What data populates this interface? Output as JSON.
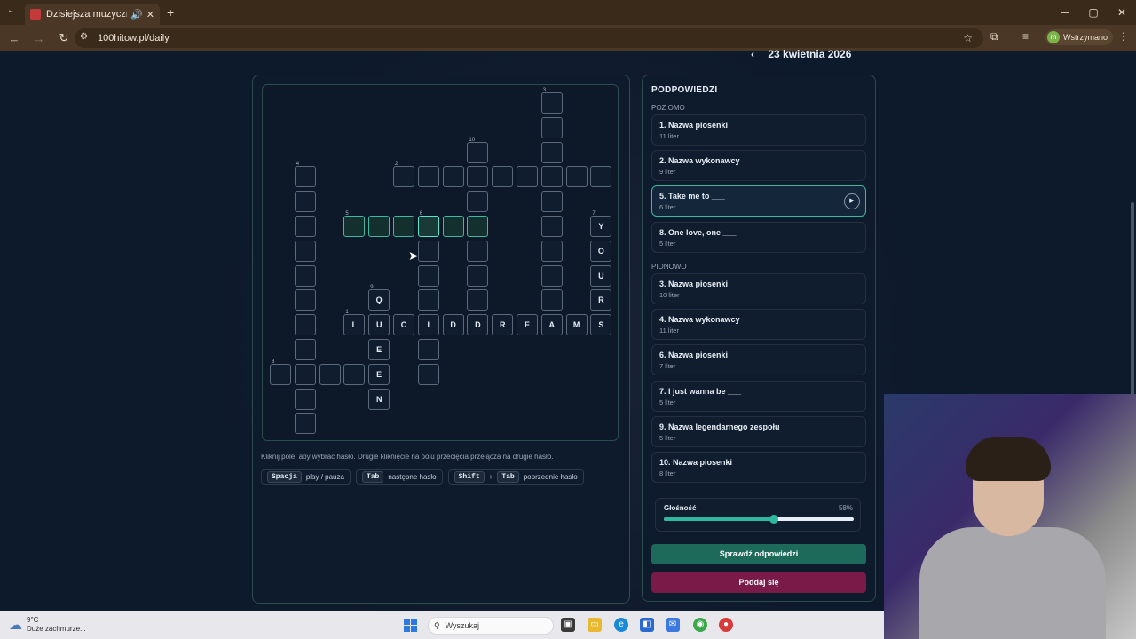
{
  "browser": {
    "tab_title": "Dzisiejsza muzyczna krzyż",
    "tab_close": "✕",
    "tab_sound": "🔊",
    "new_tab": "+",
    "url": "100hitow.pl/daily",
    "profile_initial": "m",
    "profile_label": "Wstrzymano",
    "win_min": "─",
    "win_max": "▢",
    "win_close": "✕"
  },
  "header": {
    "date_label": "23 kwietnia 2026",
    "prev_arrow": "‹"
  },
  "grid": {
    "cells": [
      {
        "r": 0,
        "c": 11,
        "letter": "",
        "num": "3"
      },
      {
        "r": 1,
        "c": 11,
        "letter": ""
      },
      {
        "r": 2,
        "c": 8,
        "letter": "",
        "num": "10"
      },
      {
        "r": 2,
        "c": 11,
        "letter": ""
      },
      {
        "r": 3,
        "c": 1,
        "letter": "",
        "num": "4"
      },
      {
        "r": 3,
        "c": 5,
        "letter": "",
        "num": "2"
      },
      {
        "r": 3,
        "c": 6,
        "letter": ""
      },
      {
        "r": 3,
        "c": 7,
        "letter": ""
      },
      {
        "r": 3,
        "c": 8,
        "letter": ""
      },
      {
        "r": 3,
        "c": 9,
        "letter": ""
      },
      {
        "r": 3,
        "c": 10,
        "letter": ""
      },
      {
        "r": 3,
        "c": 11,
        "letter": ""
      },
      {
        "r": 3,
        "c": 12,
        "letter": ""
      },
      {
        "r": 3,
        "c": 13,
        "letter": ""
      },
      {
        "r": 4,
        "c": 1,
        "letter": ""
      },
      {
        "r": 4,
        "c": 8,
        "letter": ""
      },
      {
        "r": 4,
        "c": 11,
        "letter": ""
      },
      {
        "r": 5,
        "c": 1,
        "letter": ""
      },
      {
        "r": 5,
        "c": 3,
        "letter": "",
        "num": "5",
        "hl": true
      },
      {
        "r": 5,
        "c": 4,
        "letter": "",
        "hl": true
      },
      {
        "r": 5,
        "c": 5,
        "letter": "",
        "hl": true
      },
      {
        "r": 5,
        "c": 6,
        "letter": "",
        "num": "6",
        "hl": true,
        "act": true
      },
      {
        "r": 5,
        "c": 7,
        "letter": "",
        "hl": true
      },
      {
        "r": 5,
        "c": 8,
        "letter": "",
        "hl": true
      },
      {
        "r": 5,
        "c": 11,
        "letter": ""
      },
      {
        "r": 5,
        "c": 13,
        "letter": "Y",
        "num": "7"
      },
      {
        "r": 6,
        "c": 1,
        "letter": ""
      },
      {
        "r": 6,
        "c": 6,
        "letter": ""
      },
      {
        "r": 6,
        "c": 8,
        "letter": ""
      },
      {
        "r": 6,
        "c": 11,
        "letter": ""
      },
      {
        "r": 6,
        "c": 13,
        "letter": "O"
      },
      {
        "r": 7,
        "c": 1,
        "letter": ""
      },
      {
        "r": 7,
        "c": 6,
        "letter": ""
      },
      {
        "r": 7,
        "c": 8,
        "letter": ""
      },
      {
        "r": 7,
        "c": 11,
        "letter": ""
      },
      {
        "r": 7,
        "c": 13,
        "letter": "U"
      },
      {
        "r": 8,
        "c": 1,
        "letter": ""
      },
      {
        "r": 8,
        "c": 4,
        "letter": "Q",
        "num": "9"
      },
      {
        "r": 8,
        "c": 6,
        "letter": ""
      },
      {
        "r": 8,
        "c": 8,
        "letter": ""
      },
      {
        "r": 8,
        "c": 11,
        "letter": ""
      },
      {
        "r": 8,
        "c": 13,
        "letter": "R"
      },
      {
        "r": 9,
        "c": 1,
        "letter": ""
      },
      {
        "r": 9,
        "c": 3,
        "letter": "L",
        "num": "1"
      },
      {
        "r": 9,
        "c": 4,
        "letter": "U"
      },
      {
        "r": 9,
        "c": 5,
        "letter": "C"
      },
      {
        "r": 9,
        "c": 6,
        "letter": "I"
      },
      {
        "r": 9,
        "c": 7,
        "letter": "D"
      },
      {
        "r": 9,
        "c": 8,
        "letter": "D"
      },
      {
        "r": 9,
        "c": 9,
        "letter": "R"
      },
      {
        "r": 9,
        "c": 10,
        "letter": "E"
      },
      {
        "r": 9,
        "c": 11,
        "letter": "A"
      },
      {
        "r": 9,
        "c": 12,
        "letter": "M"
      },
      {
        "r": 9,
        "c": 13,
        "letter": "S"
      },
      {
        "r": 10,
        "c": 1,
        "letter": ""
      },
      {
        "r": 10,
        "c": 4,
        "letter": "E"
      },
      {
        "r": 10,
        "c": 6,
        "letter": ""
      },
      {
        "r": 11,
        "c": 0,
        "letter": "",
        "num": "8"
      },
      {
        "r": 11,
        "c": 1,
        "letter": ""
      },
      {
        "r": 11,
        "c": 2,
        "letter": ""
      },
      {
        "r": 11,
        "c": 3,
        "letter": ""
      },
      {
        "r": 11,
        "c": 4,
        "letter": "E"
      },
      {
        "r": 11,
        "c": 6,
        "letter": ""
      },
      {
        "r": 12,
        "c": 1,
        "letter": ""
      },
      {
        "r": 12,
        "c": 4,
        "letter": "N"
      },
      {
        "r": 13,
        "c": 1,
        "letter": ""
      }
    ]
  },
  "help": {
    "hint": "Kliknij pole, aby wybrać hasło. Drugie kliknięcie na polu przecięcia przełącza na drugie hasło.",
    "keys": [
      {
        "keys": [
          "Spacja"
        ],
        "label": "play / pauza"
      },
      {
        "keys": [
          "Tab"
        ],
        "label": "następne hasło"
      },
      {
        "keys": [
          "Shift",
          "Tab"
        ],
        "label": "poprzednie hasło"
      }
    ],
    "plus": "+"
  },
  "clues": {
    "title": "PODPOWIEDZI",
    "across_label": "POZIOMO",
    "down_label": "PIONOWO",
    "across": [
      {
        "title": "1. Nazwa piosenki",
        "sub": "11 liter"
      },
      {
        "title": "2. Nazwa wykonawcy",
        "sub": "9 liter"
      },
      {
        "title": "5. Take me to ___",
        "sub": "6 liter",
        "active": true
      },
      {
        "title": "8. One love, one ___",
        "sub": "5 liter"
      }
    ],
    "down": [
      {
        "title": "3. Nazwa piosenki",
        "sub": "10 liter"
      },
      {
        "title": "4. Nazwa wykonawcy",
        "sub": "11 liter"
      },
      {
        "title": "6. Nazwa piosenki",
        "sub": "7 liter"
      },
      {
        "title": "7. I just wanna be ___",
        "sub": "5 liter"
      },
      {
        "title": "9. Nazwa legendarnego zespołu",
        "sub": "5 liter"
      },
      {
        "title": "10. Nazwa piosenki",
        "sub": "8 liter"
      }
    ],
    "play_icon": "▶"
  },
  "volume": {
    "label": "Głośność",
    "value_text": "58%",
    "value": 0.58
  },
  "buttons": {
    "check": "Sprawdź odpowiedzi",
    "give_up": "Poddaj się"
  },
  "taskbar": {
    "temp": "9°C",
    "weather": "Duże zachmurze...",
    "search_placeholder": "Wyszukaj"
  },
  "colors": {
    "accent": "#2fb8a0",
    "danger": "#7a1a48"
  }
}
